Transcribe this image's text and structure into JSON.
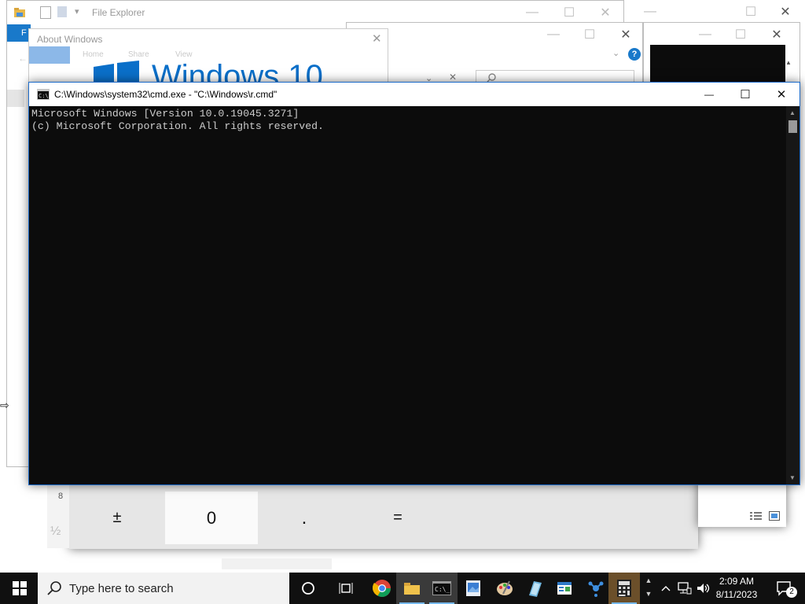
{
  "file_explorer": {
    "title": "File Explorer",
    "ribbon_tab_file": "F"
  },
  "about_windows": {
    "title": "About Windows",
    "logo_text": "Windows 10",
    "tabs_ghost": [
      "Home",
      "Share",
      "View"
    ]
  },
  "cmd": {
    "title": "C:\\Windows\\system32\\cmd.exe - \"C:\\Windows\\r.cmd\"",
    "lines": [
      "Microsoft Windows [Version 10.0.19045.3271]",
      "(c) Microsoft Corporation. All rights reserved."
    ],
    "minimize": "—",
    "maximize": "☐",
    "close": "✕"
  },
  "calculator": {
    "keys": [
      "±",
      "0",
      ".",
      "="
    ],
    "partial_number": "8",
    "fraction_hint": "½"
  },
  "taskbar": {
    "search_placeholder": "Type here to search",
    "clock_time": "2:09 AM",
    "clock_date": "8/11/2023",
    "notification_count": "2"
  },
  "colors": {
    "accent": "#0078d7",
    "cmd_bg": "#0c0c0c",
    "cmd_text": "#cccccc",
    "taskbar": "#101010"
  }
}
